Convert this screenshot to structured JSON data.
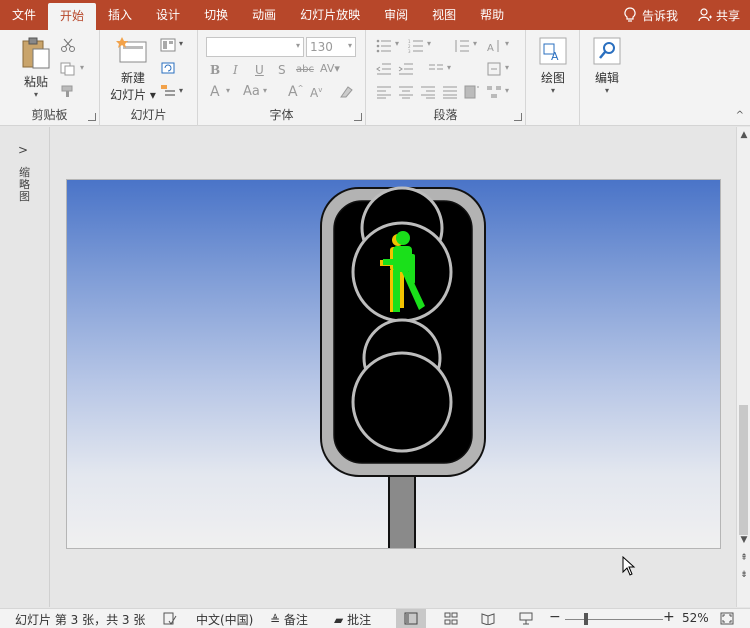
{
  "tabs": [
    "文件",
    "开始",
    "插入",
    "设计",
    "切换",
    "动画",
    "幻灯片放映",
    "审阅",
    "视图",
    "帮助"
  ],
  "active_tab": "开始",
  "tell_me": "告诉我",
  "share": "共享",
  "clipboard": {
    "paste": "粘贴",
    "label": "剪贴板"
  },
  "slides": {
    "new_slide_line1": "新建",
    "new_slide_line2": "幻灯片",
    "label": "幻灯片"
  },
  "font": {
    "name_value": "",
    "size_value": "130",
    "label": "字体"
  },
  "paragraph": {
    "label": "段落"
  },
  "drawing": {
    "label": "绘图"
  },
  "editing": {
    "label": "编辑"
  },
  "thumbnail_panel": {
    "label": "缩略图"
  },
  "status": {
    "slide_info": "幻灯片 第 3 张，共 3 张",
    "language": "中文(中国)",
    "notes": "备注",
    "comments": "批注",
    "zoom": "52%"
  },
  "colors": {
    "accent": "#b7472a",
    "light_green": "#1ae01a",
    "light_yellow": "#f2c200"
  }
}
